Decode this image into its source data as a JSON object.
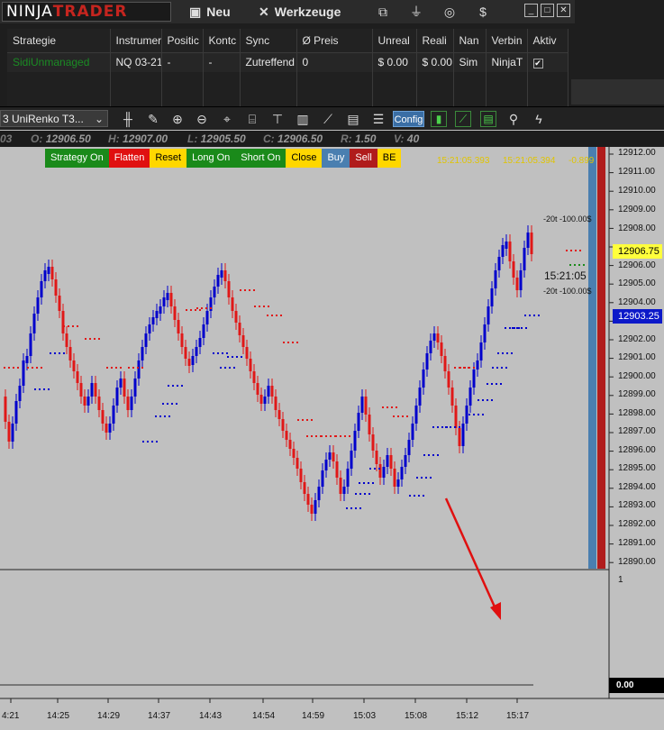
{
  "control_center": {
    "logo": {
      "left": "NINJA",
      "right": "TRADER"
    },
    "menu": {
      "new": "Neu",
      "tools": "Werkzeuge"
    },
    "toolbar_icons": [
      "workspaces-icon",
      "connect-icon",
      "help-icon",
      "dollar-icon"
    ],
    "window_buttons": [
      "minimize-icon",
      "maximize-icon",
      "close-icon"
    ],
    "grid": {
      "columns": [
        "Strategie",
        "Instrumer",
        "Positic",
        "Kontc",
        "Sync",
        "Ø Preis",
        "Unreal",
        "Reali",
        "Nan",
        "Verbin",
        "Aktiv"
      ],
      "rows": [
        [
          "SidiUnmanaged",
          "NQ 03-21",
          "-",
          "-",
          "Zutreffend",
          "0",
          "$ 0.00",
          "$ 0.00",
          "Sim",
          "NinjaT",
          "✔"
        ]
      ]
    }
  },
  "chart_toolbar": {
    "series_selector": "3 UniRenko T3...",
    "config_label": "Config"
  },
  "data_box": {
    "open_label": "O:",
    "open": "12906.50",
    "high_label": "H:",
    "high": "12907.00",
    "low_label": "L:",
    "low": "12905.50",
    "close_label": "C:",
    "close": "12906.50",
    "range_label": "R:",
    "range": "1.50",
    "volume_label": "V:",
    "volume": "40",
    "prefix": "03"
  },
  "strategy_buttons": [
    {
      "label": "Strategy On",
      "bg": "#1a8a1a",
      "fg": "#ffffff"
    },
    {
      "label": "Flatten",
      "bg": "#e01010",
      "fg": "#ffffff"
    },
    {
      "label": "Reset",
      "bg": "#ffd700",
      "fg": "#000000"
    },
    {
      "label": "Long On",
      "bg": "#1a8a1a",
      "fg": "#ffffff"
    },
    {
      "label": "Short On",
      "bg": "#1a8a1a",
      "fg": "#ffffff"
    },
    {
      "label": "Close",
      "bg": "#ffd700",
      "fg": "#000000"
    },
    {
      "label": "Buy",
      "bg": "#4a7fb0",
      "fg": "#ffffff"
    },
    {
      "label": "Sell",
      "bg": "#b01c1c",
      "fg": "#ffffff"
    },
    {
      "label": "BE",
      "bg": "#ffd700",
      "fg": "#000000"
    }
  ],
  "annotations": {
    "target_upper": "-20t -100.00$",
    "target_lower": "-20t -100.00$",
    "timer": "15:21:05",
    "top_time_1": "15:21:05.393",
    "top_time_2": "15:21:05.394",
    "top_value": "-0.899"
  },
  "price_axis": {
    "labels": [
      "12912.00",
      "12911.00",
      "12910.00",
      "12909.00",
      "12908.00",
      "12906.00",
      "12905.00",
      "12904.00",
      "12902.00",
      "12901.00",
      "12900.00",
      "12899.00",
      "12898.00",
      "12897.00",
      "12896.00",
      "12895.00",
      "12894.00",
      "12893.00",
      "12892.00",
      "12891.00",
      "12890.00"
    ],
    "current_price": "12906.75",
    "ask_price": "12903.25"
  },
  "lower_panel": {
    "top_value": "1",
    "value": "0.00"
  },
  "time_axis": [
    "4:21",
    "14:25",
    "14:29",
    "14:37",
    "14:43",
    "14:54",
    "14:59",
    "15:03",
    "15:08",
    "15:12",
    "15:17"
  ],
  "colors": {
    "up": "#0000cc",
    "down": "#e01818",
    "chart_bg": "#c0c0c0",
    "arrow": "#e01010",
    "right_blue_bar": "#4a7fb0",
    "right_red_bar": "#b01c1c"
  }
}
